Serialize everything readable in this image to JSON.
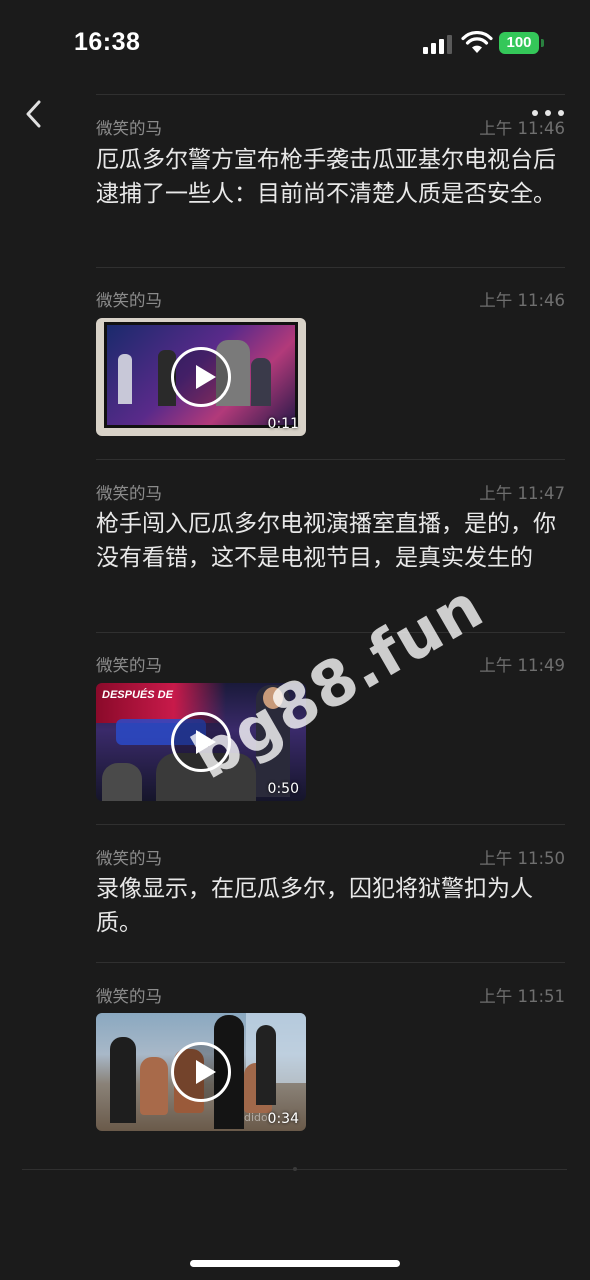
{
  "status_bar": {
    "time": "16:38",
    "battery": "100",
    "battery_color": "#34c759"
  },
  "nav": {
    "back_icon": "chevron-left-icon",
    "more_icon": "more-dots-icon"
  },
  "messages": [
    {
      "sender": "微笑的马",
      "time": "上午 11:46",
      "type": "text",
      "text": "厄瓜多尔警方宣布枪手袭击瓜亚基尔电视台后逮捕了一些人：目前尚不清楚人质是否安全。"
    },
    {
      "sender": "微笑的马",
      "time": "上午 11:46",
      "type": "video",
      "duration": "0:11"
    },
    {
      "sender": "微笑的马",
      "time": "上午 11:47",
      "type": "text",
      "text": "枪手闯入厄瓜多尔电视演播室直播，是的，你没有看错，这不是电视节目，是真实发生的"
    },
    {
      "sender": "微笑的马",
      "time": "上午 11:49",
      "type": "video",
      "duration": "0:50",
      "thumb_text": "DESPUÉS DE"
    },
    {
      "sender": "微笑的马",
      "time": "上午 11:50",
      "type": "text",
      "text": "录像显示，在厄瓜多尔，囚犯将狱警扣为人质。"
    },
    {
      "sender": "微笑的马",
      "time": "上午 11:51",
      "type": "video",
      "duration": "0:34",
      "thumb_text": "dido"
    }
  ],
  "watermark": "bg88.fun"
}
